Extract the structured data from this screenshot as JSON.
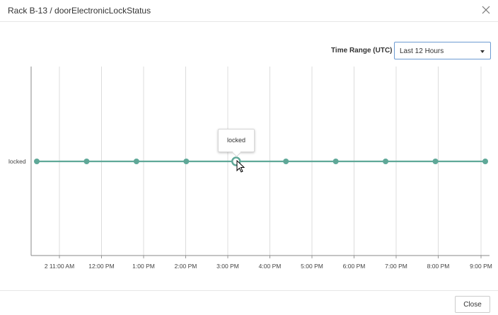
{
  "dialog": {
    "title": "Rack B-13 / doorElectronicLockStatus",
    "close_icon": "close-icon"
  },
  "time_range": {
    "label": "Time Range (UTC)",
    "selected": "Last 12 Hours"
  },
  "chart_data": {
    "type": "line",
    "y_categories": [
      "locked"
    ],
    "x_tick_labels": [
      "2 11:00 AM",
      "12:00 PM",
      "1:00 PM",
      "2:00 PM",
      "3:00 PM",
      "4:00 PM",
      "5:00 PM",
      "6:00 PM",
      "7:00 PM",
      "8:00 PM",
      "9:00 PM"
    ],
    "series": [
      {
        "values": [
          "locked",
          "locked",
          "locked",
          "locked",
          "locked",
          "locked",
          "locked",
          "locked",
          "locked",
          "locked",
          "locked"
        ],
        "color": "#5fa898"
      }
    ],
    "point_count": 10,
    "grid": true,
    "tooltip": {
      "text": "locked",
      "point_index": 4
    }
  },
  "footer": {
    "close_label": "Close"
  }
}
